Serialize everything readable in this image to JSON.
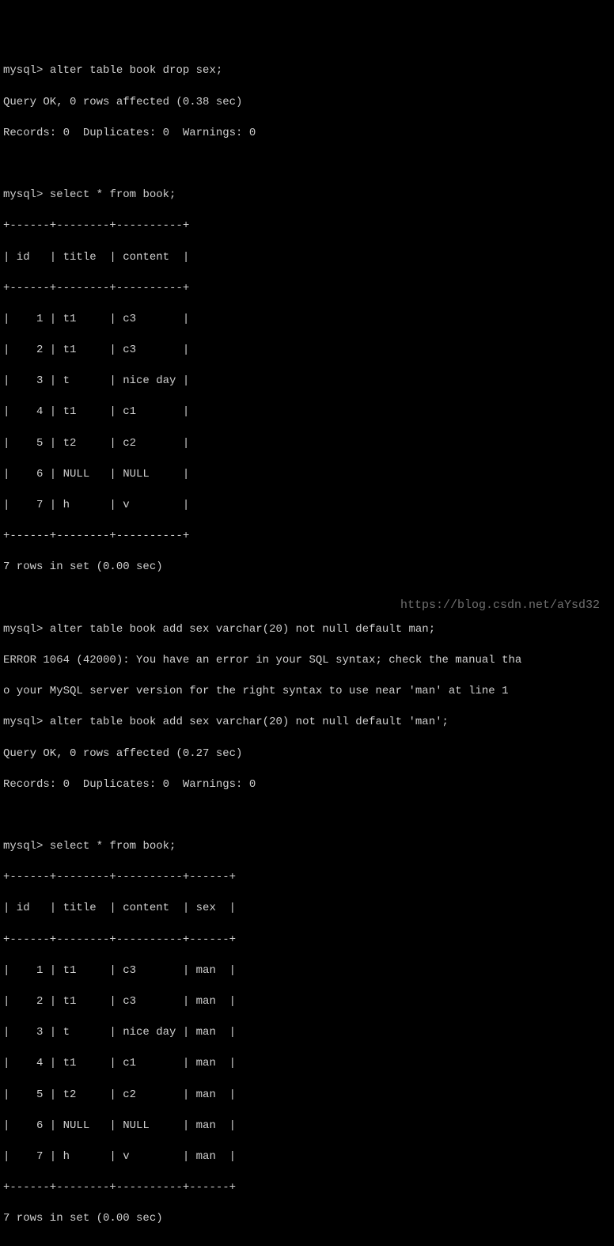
{
  "prompt": "mysql>",
  "cmd1": "alter table book drop sex;",
  "res1a": "Query OK, 0 rows affected (0.38 sec)",
  "res1b": "Records: 0  Duplicates: 0  Warnings: 0",
  "cmd2": "select * from book;",
  "table1": {
    "border_top": "+------+--------+----------+",
    "header": "| id   | title  | content  |",
    "border_mid": "+------+--------+----------+",
    "rows": [
      "|    1 | t1     | c3       |",
      "|    2 | t1     | c3       |",
      "|    3 | t      | nice day |",
      "|    4 | t1     | c1       |",
      "|    5 | t2     | c2       |",
      "|    6 | NULL   | NULL     |",
      "|    7 | h      | v        |"
    ],
    "border_bot": "+------+--------+----------+"
  },
  "res2": "7 rows in set (0.00 sec)",
  "cmd3": "alter table book add sex varchar(20) not null default man;",
  "err3a": "ERROR 1064 (42000): You have an error in your SQL syntax; check the manual tha",
  "err3b": "o your MySQL server version for the right syntax to use near 'man' at line 1",
  "cmd4": "alter table book add sex varchar(20) not null default 'man';",
  "res4a": "Query OK, 0 rows affected (0.27 sec)",
  "res4b": "Records: 0  Duplicates: 0  Warnings: 0",
  "cmd5": "select * from book;",
  "table2": {
    "border_top": "+------+--------+----------+------+",
    "header": "| id   | title  | content  | sex  |",
    "border_mid": "+------+--------+----------+------+",
    "rows": [
      "|    1 | t1     | c3       | man  |",
      "|    2 | t1     | c3       | man  |",
      "|    3 | t      | nice day | man  |",
      "|    4 | t1     | c1       | man  |",
      "|    5 | t2     | c2       | man  |",
      "|    6 | NULL   | NULL     | man  |",
      "|    7 | h      | v        | man  |"
    ],
    "border_bot": "+------+--------+----------+------+"
  },
  "res5": "7 rows in set (0.00 sec)",
  "watermark": "https://blog.csdn.net/aYsd32",
  "chart_data": {
    "type": "table",
    "tables": [
      {
        "columns": [
          "id",
          "title",
          "content"
        ],
        "rows": [
          [
            1,
            "t1",
            "c3"
          ],
          [
            2,
            "t1",
            "c3"
          ],
          [
            3,
            "t",
            "nice day"
          ],
          [
            4,
            "t1",
            "c1"
          ],
          [
            5,
            "t2",
            "c2"
          ],
          [
            6,
            "NULL",
            "NULL"
          ],
          [
            7,
            "h",
            "v"
          ]
        ]
      },
      {
        "columns": [
          "id",
          "title",
          "content",
          "sex"
        ],
        "rows": [
          [
            1,
            "t1",
            "c3",
            "man"
          ],
          [
            2,
            "t1",
            "c3",
            "man"
          ],
          [
            3,
            "t",
            "nice day",
            "man"
          ],
          [
            4,
            "t1",
            "c1",
            "man"
          ],
          [
            5,
            "t2",
            "c2",
            "man"
          ],
          [
            6,
            "NULL",
            "NULL",
            "man"
          ],
          [
            7,
            "h",
            "v",
            "man"
          ]
        ]
      }
    ]
  }
}
